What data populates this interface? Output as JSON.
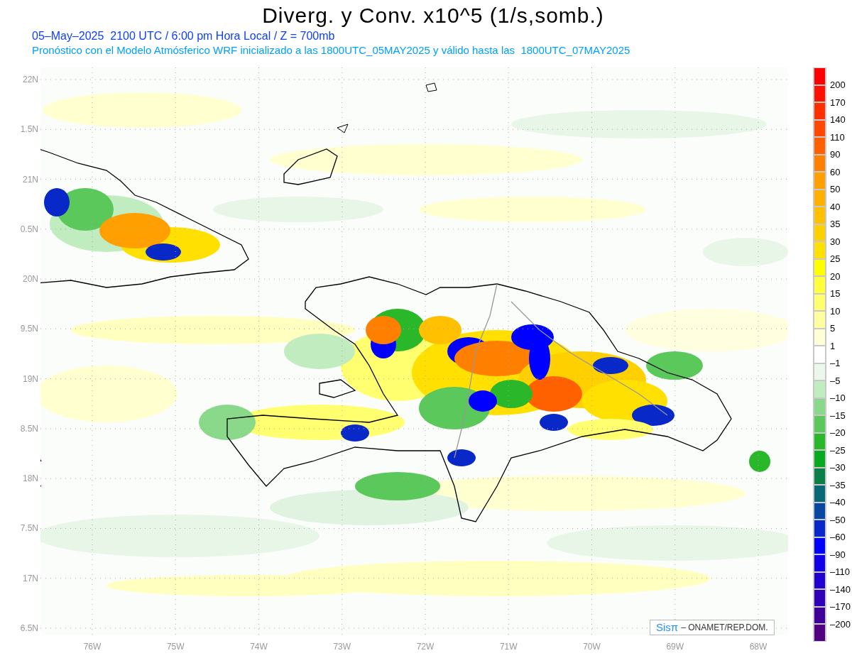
{
  "title": "Diverg. y Conv. x10^5 (1/s,somb.)",
  "subtitle": "05–May–2025  2100 UTC / 6:00 pm Hora Local / Z = 700mb",
  "forecast_note": "Pronóstico con el Modelo Atmósferico WRF inicializado a las 1800UTC_05MAY2025 y válido hasta las  1800UTC_07MAY2025",
  "y_axis_labels": [
    "22N",
    "1.5N",
    "21N",
    "0.5N",
    "20N",
    "9.5N",
    "19N",
    "8.5N",
    "18N",
    "7.5N",
    "17N",
    "6.5N"
  ],
  "x_axis_labels": [
    "76W",
    "75W",
    "74W",
    "73W",
    "72W",
    "71W",
    "70W",
    "69W",
    "68W"
  ],
  "credit": {
    "logo": "Sisπ",
    "text": "– ONAMET/REP.DOM."
  },
  "color_scale": {
    "bins": [
      {
        "color": "#ff0000"
      },
      {
        "color": "#ff1000"
      },
      {
        "color": "#ff3000"
      },
      {
        "color": "#ff4800"
      },
      {
        "color": "#ff6000"
      },
      {
        "color": "#ff8000"
      },
      {
        "color": "#ffa000"
      },
      {
        "color": "#ffb000"
      },
      {
        "color": "#ffc000"
      },
      {
        "color": "#ffd000"
      },
      {
        "color": "#ffe000"
      },
      {
        "color": "#ffff00"
      },
      {
        "color": "#ffff40"
      },
      {
        "color": "#ffff70"
      },
      {
        "color": "#ffffa0"
      },
      {
        "color": "#ffffd8"
      },
      {
        "color": "#ffffff"
      },
      {
        "color": "#eaf7ea"
      },
      {
        "color": "#c0ecc0"
      },
      {
        "color": "#8ad88a"
      },
      {
        "color": "#5ac85a"
      },
      {
        "color": "#2ab82a"
      },
      {
        "color": "#08a820"
      },
      {
        "color": "#0a8048"
      },
      {
        "color": "#086878"
      },
      {
        "color": "#0848a0"
      },
      {
        "color": "#0828c8"
      },
      {
        "color": "#0000ff"
      },
      {
        "color": "#1000e8"
      },
      {
        "color": "#2000d0"
      },
      {
        "color": "#3000b8"
      },
      {
        "color": "#400098"
      },
      {
        "color": "#500080"
      }
    ],
    "labels": [
      "200",
      "170",
      "140",
      "110",
      "90",
      "60",
      "50",
      "40",
      "35",
      "30",
      "25",
      "20",
      "15",
      "10",
      "5",
      "1",
      "–1",
      "–5",
      "–10",
      "–15",
      "–20",
      "–25",
      "–30",
      "–35",
      "–40",
      "–50",
      "–60",
      "–90",
      "–110",
      "–140",
      "–170",
      "–200"
    ]
  }
}
